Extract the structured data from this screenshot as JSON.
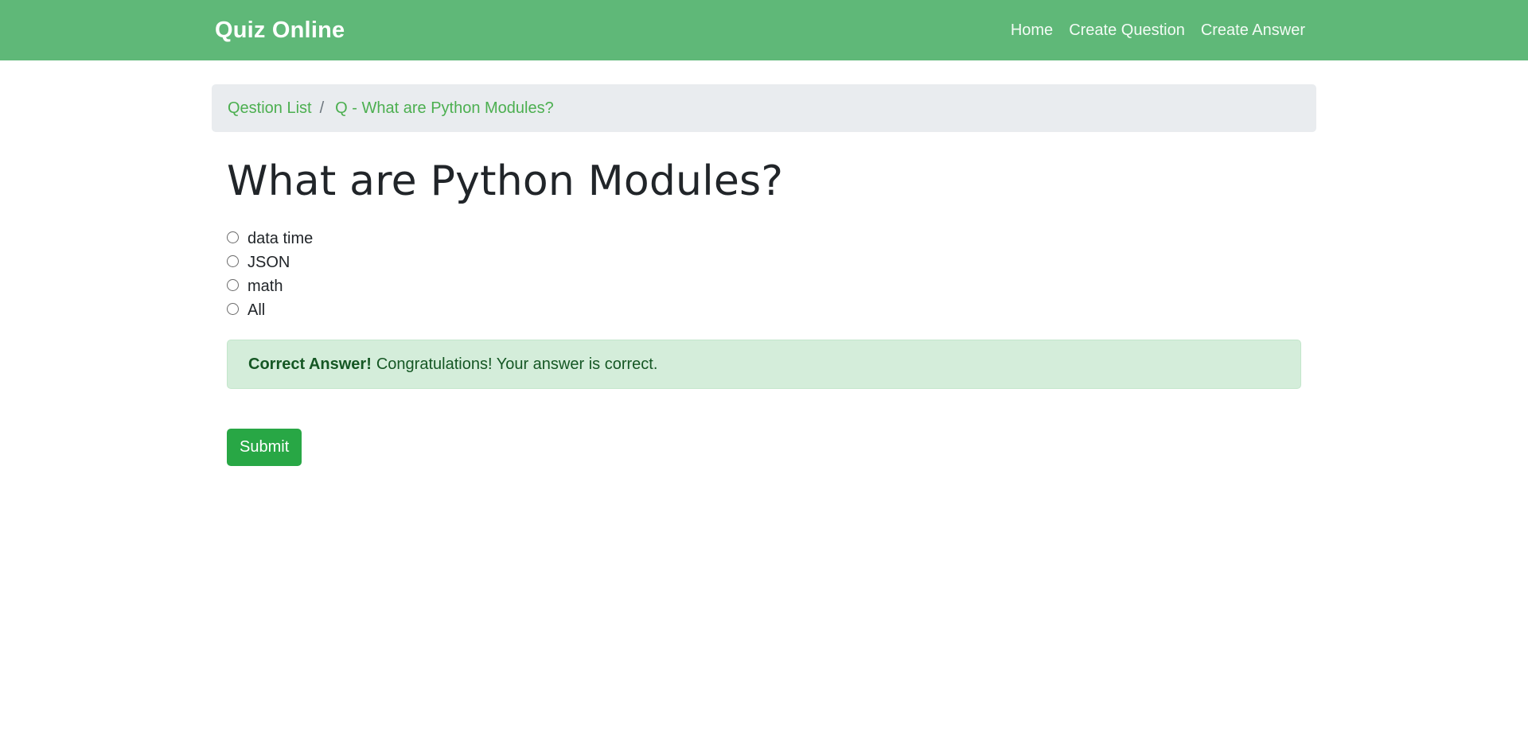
{
  "navbar": {
    "brand": "Quiz Online",
    "links": [
      {
        "label": "Home"
      },
      {
        "label": "Create Question"
      },
      {
        "label": "Create Answer"
      }
    ]
  },
  "breadcrumb": {
    "items": [
      {
        "label": "Qestion List"
      },
      {
        "label": "Q - What are Python Modules?"
      }
    ],
    "separator": "/"
  },
  "question": {
    "title": "What are Python Modules?",
    "choices": [
      {
        "label": "data time"
      },
      {
        "label": "JSON"
      },
      {
        "label": "math"
      },
      {
        "label": "All"
      }
    ]
  },
  "alert": {
    "strong": "Correct Answer!",
    "message": "Congratulations! Your answer is correct."
  },
  "form": {
    "submit_label": "Submit"
  },
  "colors": {
    "navbar": "#5fb878",
    "link": "#4caf50",
    "alert_bg": "#d4edda",
    "alert_text": "#155724",
    "submit": "#28a745"
  }
}
